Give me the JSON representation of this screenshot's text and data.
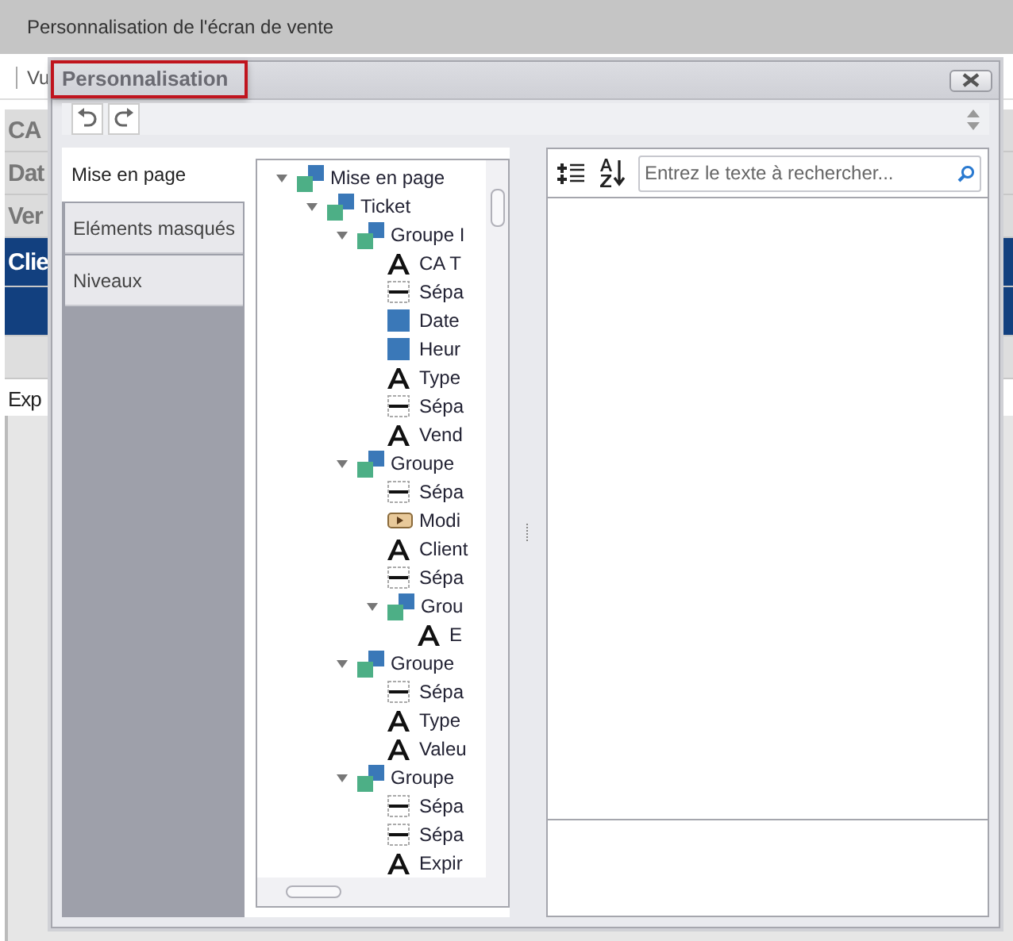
{
  "app": {
    "title": "Personnalisation de l'écran de vente",
    "toolbar_text": "Vu",
    "rows": [
      {
        "kind": "gray",
        "left": "CA",
        "right": ""
      },
      {
        "kind": "gray",
        "left": "Dat",
        "right": ""
      },
      {
        "kind": "gray",
        "left": "Ver",
        "right": ""
      },
      {
        "kind": "blue",
        "left": "Clie",
        "right": ""
      },
      {
        "kind": "blue",
        "left": "",
        "right": ""
      },
      {
        "kind": "light",
        "left": "",
        "right": ""
      },
      {
        "kind": "white",
        "left": "Exp",
        "right": ""
      }
    ]
  },
  "dialog": {
    "title": "Personnalisation",
    "tabs": [
      {
        "label": "Mise en page",
        "selected": true
      },
      {
        "label": "Eléments masqués",
        "selected": false
      },
      {
        "label": "Niveaux",
        "selected": false
      }
    ],
    "tree": [
      {
        "label": "Mise en page",
        "kind": "group",
        "expanded": true,
        "children": [
          {
            "label": "Ticket",
            "kind": "group",
            "expanded": true,
            "children": [
              {
                "label": "Groupe I",
                "kind": "group",
                "expanded": true,
                "children": [
                  {
                    "label": "CA T",
                    "kind": "text"
                  },
                  {
                    "label": "Sépa",
                    "kind": "separator"
                  },
                  {
                    "label": "Date",
                    "kind": "image"
                  },
                  {
                    "label": "Heur",
                    "kind": "image"
                  },
                  {
                    "label": "Type",
                    "kind": "text"
                  },
                  {
                    "label": "Sépa",
                    "kind": "separator"
                  },
                  {
                    "label": "Vend",
                    "kind": "text"
                  }
                ]
              },
              {
                "label": "Groupe",
                "kind": "group",
                "expanded": true,
                "children": [
                  {
                    "label": "Sépa",
                    "kind": "separator"
                  },
                  {
                    "label": "Modi",
                    "kind": "button"
                  },
                  {
                    "label": "Client",
                    "kind": "text"
                  },
                  {
                    "label": "Sépa",
                    "kind": "separator"
                  },
                  {
                    "label": "Grou",
                    "kind": "group",
                    "expanded": true,
                    "children": [
                      {
                        "label": "E",
                        "kind": "text"
                      }
                    ]
                  }
                ]
              },
              {
                "label": "Groupe",
                "kind": "group",
                "expanded": true,
                "children": [
                  {
                    "label": "Sépa",
                    "kind": "separator"
                  },
                  {
                    "label": "Type",
                    "kind": "text"
                  },
                  {
                    "label": "Valeu",
                    "kind": "text"
                  }
                ]
              },
              {
                "label": "Groupe",
                "kind": "group",
                "expanded": true,
                "children": [
                  {
                    "label": "Sépa",
                    "kind": "separator"
                  },
                  {
                    "label": "Sépa",
                    "kind": "separator"
                  },
                  {
                    "label": "Expir",
                    "kind": "text"
                  }
                ]
              }
            ]
          }
        ]
      }
    ],
    "search": {
      "placeholder": "Entrez le texte à rechercher..."
    }
  }
}
